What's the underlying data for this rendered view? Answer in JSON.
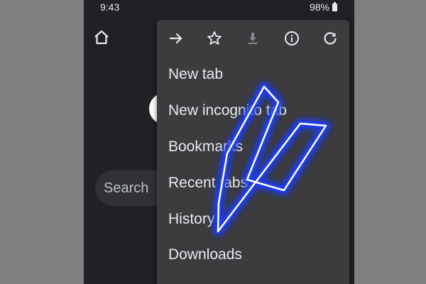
{
  "status_bar": {
    "time": "9:43",
    "battery": "98%"
  },
  "page": {
    "search_placeholder": "Search"
  },
  "menu": {
    "toolbar": [
      "forward-icon",
      "bookmark-star-icon",
      "download-icon",
      "info-icon",
      "refresh-icon"
    ],
    "items": [
      {
        "label": "New tab"
      },
      {
        "label": "New incognito tab"
      },
      {
        "label": "Bookmarks"
      },
      {
        "label": "Recent tabs"
      },
      {
        "label": "History"
      },
      {
        "label": "Downloads"
      }
    ]
  },
  "colors": {
    "page_background": "#202124",
    "menu_background": "#3c3c3f",
    "text": "#e8eaed",
    "annotation_arrow": "#1e3cff",
    "outer_background": "#808080"
  }
}
